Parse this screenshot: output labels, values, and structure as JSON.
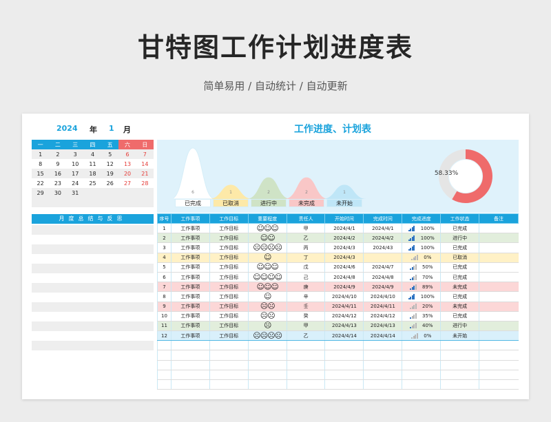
{
  "header": {
    "title": "甘特图工作计划进度表",
    "subtitle": "简单易用 / 自动统计 / 自动更新"
  },
  "calendar": {
    "year": "2024",
    "year_unit": "年",
    "month": "1",
    "month_unit": "月",
    "weekdays": [
      "一",
      "二",
      "三",
      "四",
      "五",
      "六",
      "日"
    ],
    "weeks": [
      [
        "1",
        "2",
        "3",
        "4",
        "5",
        "6",
        "7"
      ],
      [
        "8",
        "9",
        "10",
        "11",
        "12",
        "13",
        "14"
      ],
      [
        "15",
        "16",
        "17",
        "18",
        "19",
        "20",
        "21"
      ],
      [
        "22",
        "23",
        "24",
        "25",
        "26",
        "27",
        "28"
      ],
      [
        "29",
        "30",
        "31",
        "",
        "",
        "",
        ""
      ]
    ]
  },
  "summary": {
    "title": "月度总结与反思"
  },
  "section": {
    "title": "工作进度、计划表"
  },
  "dashboard": {
    "percent_label": "58.33%",
    "percent_value": 58.33,
    "colors": {
      "done": "#ef6b6b",
      "track": "#e5e5e5"
    },
    "status_counts": [
      {
        "label": "已完成",
        "count": "6",
        "value": 6,
        "color": "#ffffff"
      },
      {
        "label": "已取消",
        "count": "1",
        "value": 1,
        "color": "#fde9a8"
      },
      {
        "label": "进行中",
        "count": "2",
        "value": 2,
        "color": "#cfe3c6"
      },
      {
        "label": "未完成",
        "count": "2",
        "value": 2,
        "color": "#f9c7c7"
      },
      {
        "label": "未开始",
        "count": "1",
        "value": 1,
        "color": "#bfe6f7"
      }
    ]
  },
  "table": {
    "headers": [
      "序号",
      "工作事项",
      "工作目标",
      "重要程度",
      "责任人",
      "开始时间",
      "完成时间",
      "完成进度",
      "工作状态",
      "备注"
    ],
    "rows": [
      {
        "no": "1",
        "task": "工作事项",
        "goal": "工作目标",
        "importance": "☺☺☺",
        "owner": "甲",
        "start": "2024/4/1",
        "end": "2024/4/1",
        "progress": "100%",
        "level": 1,
        "status": "已完成",
        "note": "",
        "color": "white"
      },
      {
        "no": "2",
        "task": "工作事项",
        "goal": "工作目标",
        "importance": "☺☺",
        "owner": "乙",
        "start": "2024/4/2",
        "end": "2024/4/2",
        "progress": "100%",
        "level": 1,
        "status": "进行中",
        "note": "",
        "color": "green"
      },
      {
        "no": "3",
        "task": "工作事项",
        "goal": "工作目标",
        "importance": "☹☹☹☹",
        "owner": "丙",
        "start": "2024/4/3",
        "end": "2024/43",
        "progress": "100%",
        "level": 1,
        "status": "已完成",
        "note": "",
        "color": "white"
      },
      {
        "no": "4",
        "task": "工作事项",
        "goal": "工作目标",
        "importance": "☺",
        "owner": "丁",
        "start": "2024/4/3",
        "end": "",
        "progress": "0%",
        "level": 0,
        "status": "已取消",
        "note": "",
        "color": "yellow"
      },
      {
        "no": "5",
        "task": "工作事项",
        "goal": "工作目标",
        "importance": "☺☺☺",
        "owner": "戊",
        "start": "2024/4/6",
        "end": "2024/4/7",
        "progress": "50%",
        "level": 0.5,
        "status": "已完成",
        "note": "",
        "color": "white"
      },
      {
        "no": "6",
        "task": "工作事项",
        "goal": "工作目标",
        "importance": "☺☺☺☺",
        "owner": "己",
        "start": "2024/4/8",
        "end": "2024/4/8",
        "progress": "70%",
        "level": 0.7,
        "status": "已完成",
        "note": "",
        "color": "white"
      },
      {
        "no": "7",
        "task": "工作事项",
        "goal": "工作目标",
        "importance": "☺☺☺",
        "owner": "庚",
        "start": "2024/4/9",
        "end": "2024/4/9",
        "progress": "89%",
        "level": 0.89,
        "status": "未完成",
        "note": "",
        "color": "red"
      },
      {
        "no": "8",
        "task": "工作事项",
        "goal": "工作目标",
        "importance": "☺",
        "owner": "辛",
        "start": "2024/4/10",
        "end": "2024/4/10",
        "progress": "100%",
        "level": 1,
        "status": "已完成",
        "note": "",
        "color": "white"
      },
      {
        "no": "9",
        "task": "工作事项",
        "goal": "工作目标",
        "importance": "☹☹",
        "owner": "壬",
        "start": "2024/4/11",
        "end": "2024/4/11",
        "progress": "20%",
        "level": 0.2,
        "status": "未完成",
        "note": "",
        "color": "red"
      },
      {
        "no": "10",
        "task": "工作事项",
        "goal": "工作目标",
        "importance": "☹☹",
        "owner": "癸",
        "start": "2024/4/12",
        "end": "2024/4/12",
        "progress": "35%",
        "level": 0.35,
        "status": "已完成",
        "note": "",
        "color": "white"
      },
      {
        "no": "11",
        "task": "工作事项",
        "goal": "工作目标",
        "importance": "☹",
        "owner": "甲",
        "start": "2024/4/13",
        "end": "2024/4/13",
        "progress": "40%",
        "level": 0.4,
        "status": "进行中",
        "note": "",
        "color": "green"
      },
      {
        "no": "12",
        "task": "工作事项",
        "goal": "工作目标",
        "importance": "☹☹☹☹",
        "owner": "乙",
        "start": "2024/4/14",
        "end": "2024/4/14",
        "progress": "0%",
        "level": 0,
        "status": "未开始",
        "note": "",
        "color": "blue"
      }
    ]
  }
}
